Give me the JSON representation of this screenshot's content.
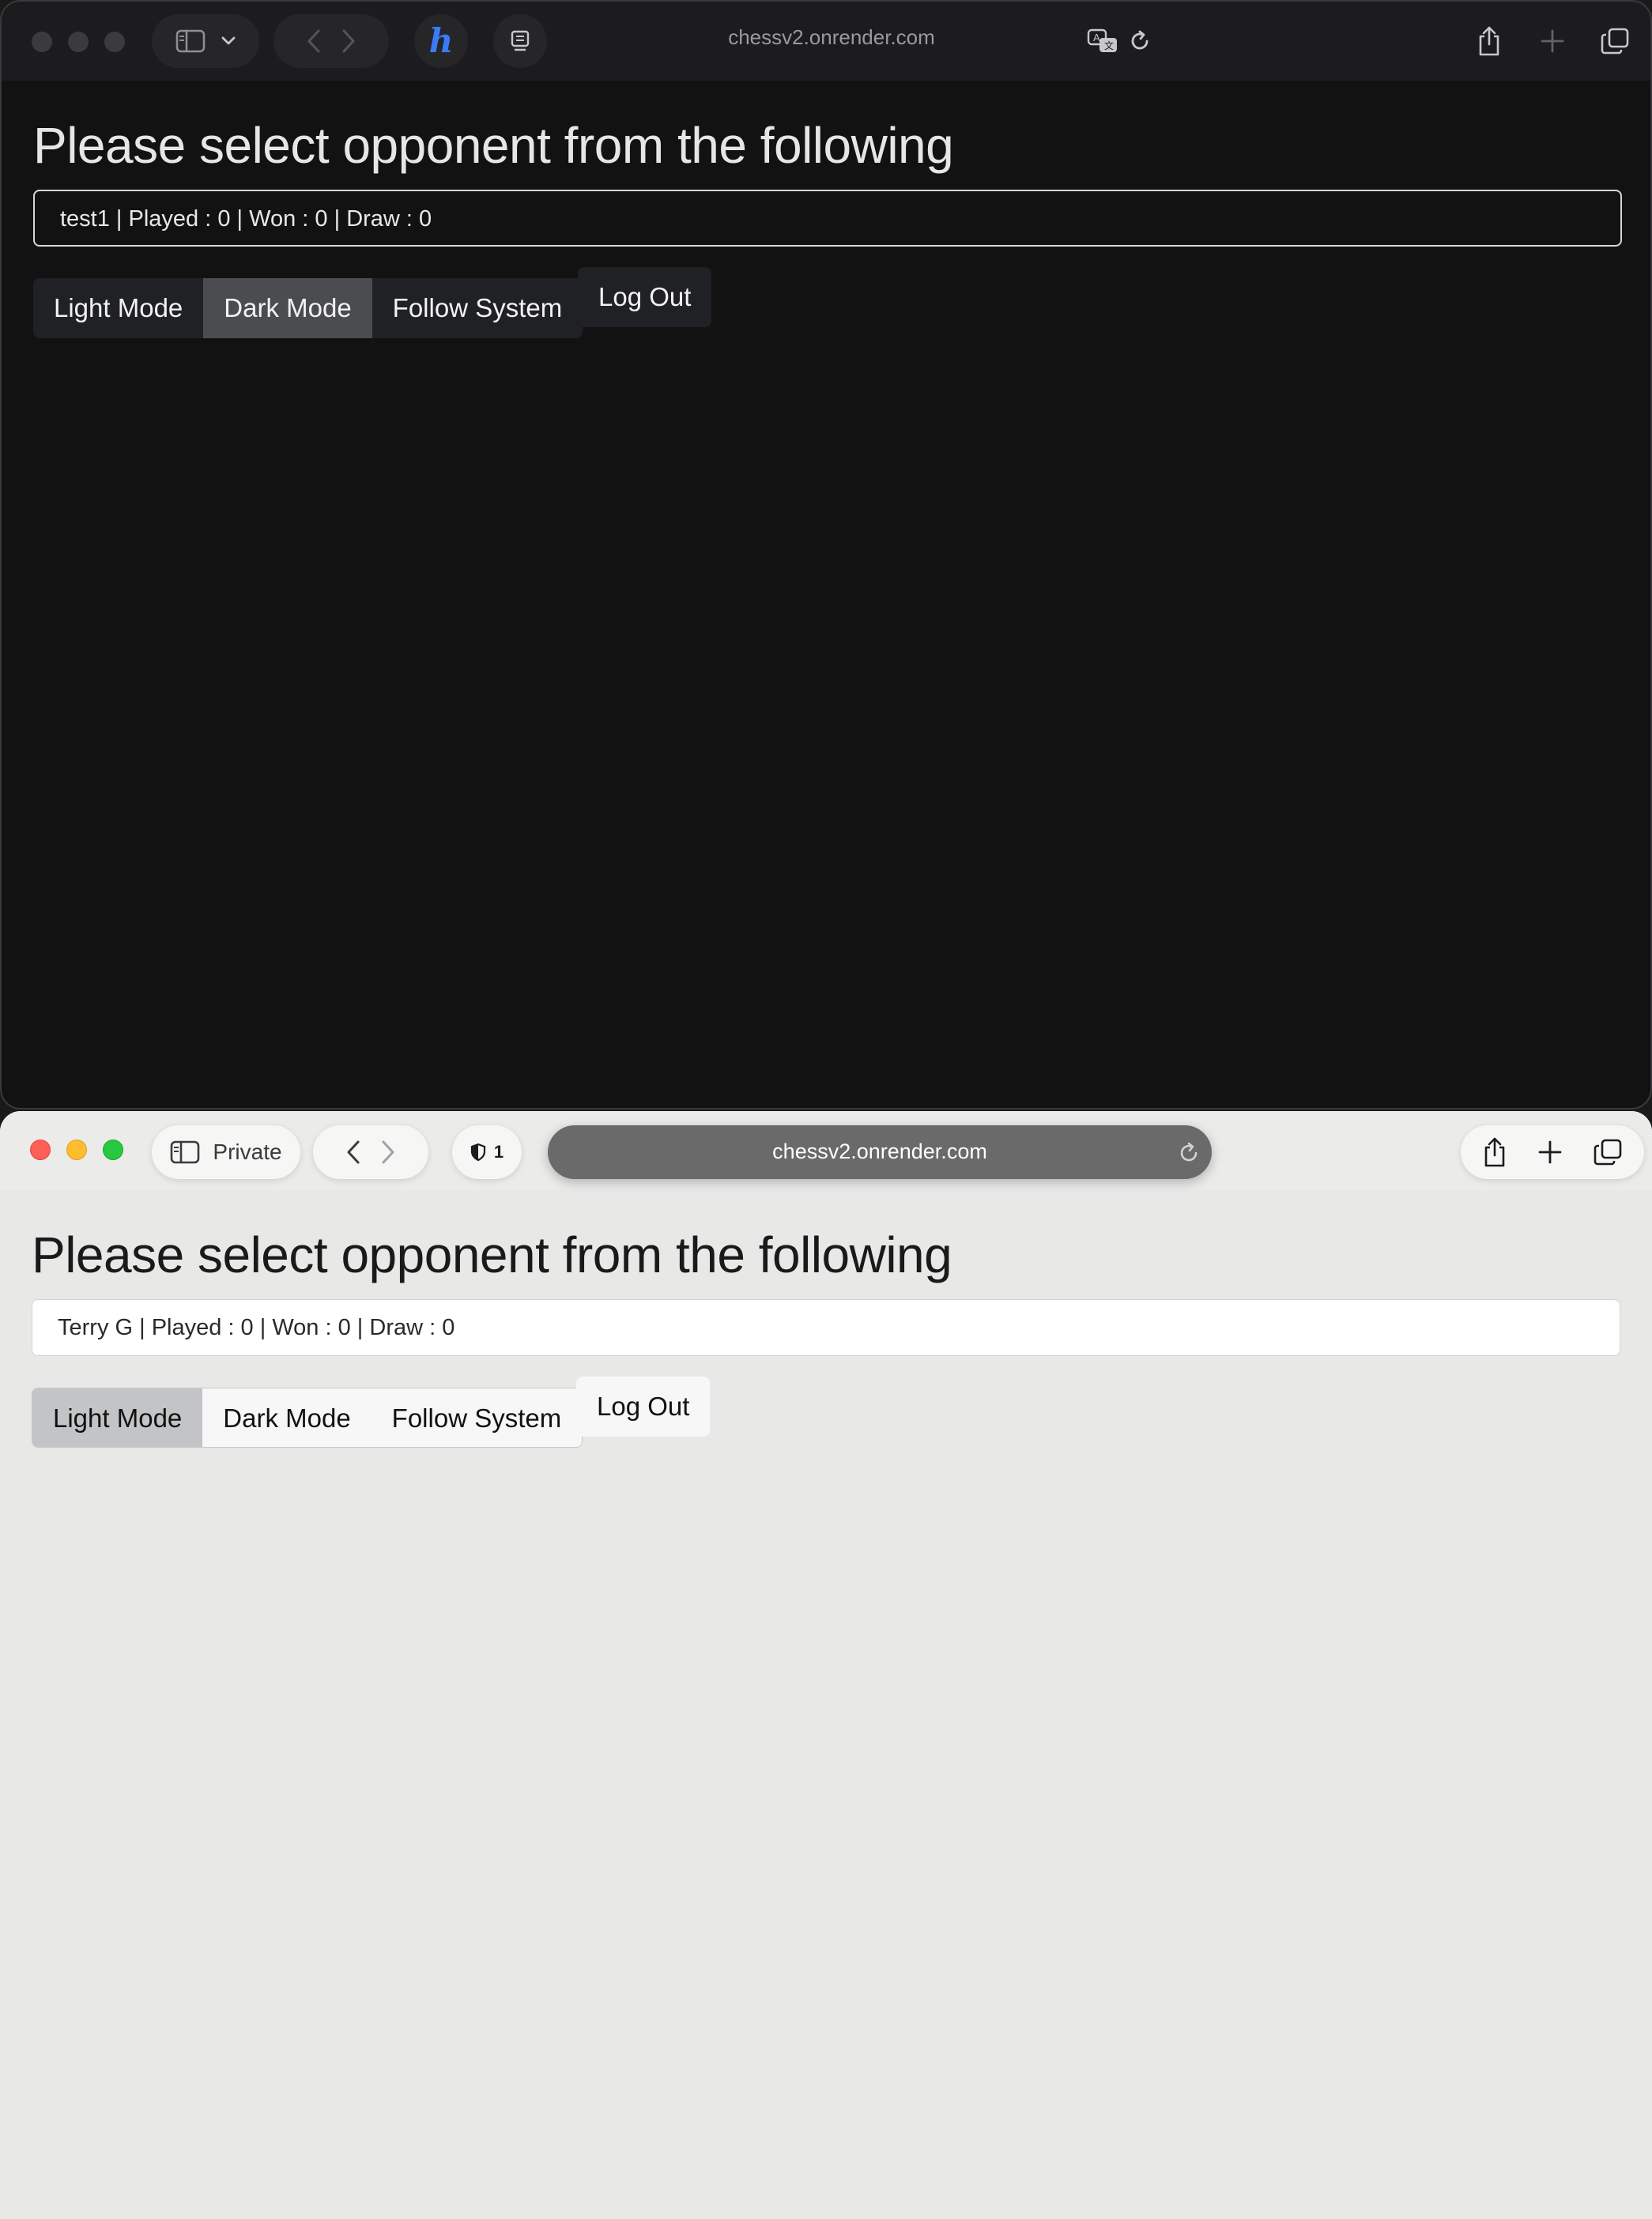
{
  "dark_window": {
    "url": "chessv2.onrender.com",
    "heading": "Please select opponent from the following",
    "opponent_entry": "test1 | Played : 0 | Won : 0 | Draw : 0",
    "mode_buttons": [
      "Light Mode",
      "Dark Mode",
      "Follow System"
    ],
    "active_mode": "Dark Mode",
    "logout_label": "Log Out",
    "extension_icon_letter": "h"
  },
  "light_window": {
    "url": "chessv2.onrender.com",
    "private_label": "Private",
    "shield_count": "1",
    "heading": "Please select opponent from the following",
    "opponent_entry": "Terry G | Played : 0 | Won : 0 | Draw : 0",
    "mode_buttons": [
      "Light Mode",
      "Dark Mode",
      "Follow System"
    ],
    "active_mode": "Light Mode",
    "logout_label": "Log Out"
  },
  "icons": {
    "sidebar": "sidebar-icon",
    "back": "chevron-left-icon",
    "forward": "chevron-right-icon",
    "share": "share-icon",
    "new_tab": "plus-icon",
    "tabs": "tab-overview-icon",
    "reload": "reload-icon",
    "translate": "translate-icon",
    "reader": "reader-icon",
    "shield": "shield-icon"
  },
  "colors": {
    "dark_bg": "#121213",
    "dark_active_mode": "#4a4c4f",
    "light_bg": "#e8e8e7",
    "light_active_mode": "#c3c4c6",
    "extension_blue": "#3b7bf7"
  }
}
